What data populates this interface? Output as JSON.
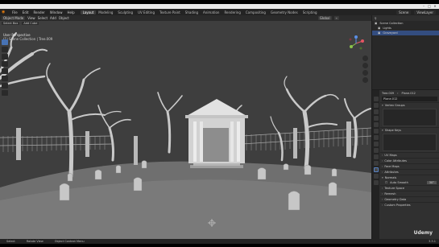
{
  "titlebar": {
    "minimize": "–",
    "maximize": "□",
    "close": "✕"
  },
  "menu": {
    "items": [
      "File",
      "Edit",
      "Render",
      "Window",
      "Help"
    ],
    "workspaces": [
      "Layout",
      "Modeling",
      "Sculpting",
      "UV Editing",
      "Texture Paint",
      "Shading",
      "Animation",
      "Rendering",
      "Compositing",
      "Geometry Nodes",
      "Scripting"
    ],
    "active_workspace": "Layout",
    "scene_label": "Scene",
    "view_layer_label": "ViewLayer"
  },
  "viewport": {
    "mode": "Object Mode",
    "view": "View",
    "select": "Select",
    "add": "Add",
    "object": "Object",
    "orientation": "Global",
    "toolbar2": [
      "Select Box",
      "Add Cube"
    ],
    "perspective_label": "User Perspective",
    "collection_label": "(1) Scene Collection | Tree.009"
  },
  "outliner": {
    "title": "Scene Collection",
    "rows": [
      {
        "label": "Scene Collection",
        "selected": false
      },
      {
        "label": "Lights",
        "selected": false
      },
      {
        "label": "Graveyard",
        "selected": true
      }
    ]
  },
  "properties": {
    "object_name": "Tree.009",
    "mesh_name": "Plane.012",
    "data_field": "Plane.012",
    "sections": [
      {
        "label": "Vertex Groups",
        "expanded": true,
        "has_box": true
      },
      {
        "label": "Shape Keys",
        "expanded": true,
        "has_box": true
      },
      {
        "label": "UV Maps",
        "expanded": false
      },
      {
        "label": "Color Attributes",
        "expanded": false
      },
      {
        "label": "Face Maps",
        "expanded": false
      },
      {
        "label": "Attributes",
        "expanded": false
      },
      {
        "label": "Normals",
        "expanded": true
      },
      {
        "label": "Texture Space",
        "expanded": false
      },
      {
        "label": "Remesh",
        "expanded": false
      },
      {
        "label": "Geometry Data",
        "expanded": false
      },
      {
        "label": "Custom Properties",
        "expanded": false
      }
    ],
    "auto_smooth_label": "Auto Smooth",
    "auto_smooth_value": "30°"
  },
  "status": {
    "items": [
      "Select",
      "Rotate View",
      "Object Context Menu"
    ],
    "version": "3.3.1"
  },
  "watermark": "Udemy",
  "colors": {
    "accent": "#4772b3",
    "blender_orange": "#e87d0d",
    "viewport_bg": "#3d3d3d"
  }
}
